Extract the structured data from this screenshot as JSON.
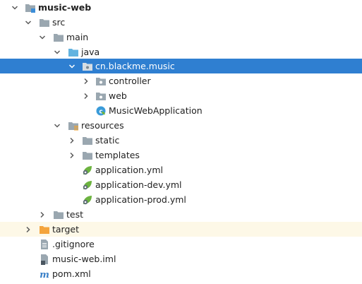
{
  "colors": {
    "selected_bg": "#2f7fd1",
    "excluded_bg": "#fdf8e7",
    "folder_gray": "#9aa7b0",
    "folder_blue": "#62b3e0",
    "folder_orange": "#f4a43c",
    "spring_green": "#6cb33f"
  },
  "tree": {
    "root": {
      "label": "music-web",
      "icon": "module-folder-icon",
      "expanded": true
    },
    "src": {
      "label": "src",
      "icon": "folder-icon",
      "expanded": true
    },
    "main": {
      "label": "main",
      "icon": "folder-icon",
      "expanded": true
    },
    "java": {
      "label": "java",
      "icon": "source-root-folder-icon",
      "expanded": true
    },
    "package": {
      "label": "cn.blackme.music",
      "icon": "package-icon",
      "expanded": true,
      "selected": true
    },
    "controller": {
      "label": "controller",
      "icon": "package-icon",
      "expanded": false
    },
    "web": {
      "label": "web",
      "icon": "package-icon",
      "expanded": false
    },
    "app_class": {
      "label": "MusicWebApplication",
      "icon": "spring-boot-class-icon"
    },
    "resources": {
      "label": "resources",
      "icon": "resources-folder-icon",
      "expanded": true
    },
    "static": {
      "label": "static",
      "icon": "folder-icon",
      "expanded": false
    },
    "templates": {
      "label": "templates",
      "icon": "folder-icon",
      "expanded": false
    },
    "app_yml": {
      "label": "application.yml",
      "icon": "spring-yml-icon"
    },
    "app_dev_yml": {
      "label": "application-dev.yml",
      "icon": "spring-yml-icon"
    },
    "app_prod_yml": {
      "label": "application-prod.yml",
      "icon": "spring-yml-icon"
    },
    "test": {
      "label": "test",
      "icon": "folder-icon",
      "expanded": false
    },
    "target": {
      "label": "target",
      "icon": "excluded-folder-icon",
      "expanded": false
    },
    "gitignore": {
      "label": ".gitignore",
      "icon": "text-file-icon"
    },
    "iml": {
      "label": "music-web.iml",
      "icon": "module-file-icon"
    },
    "pom": {
      "label": "pom.xml",
      "icon": "maven-icon"
    }
  }
}
